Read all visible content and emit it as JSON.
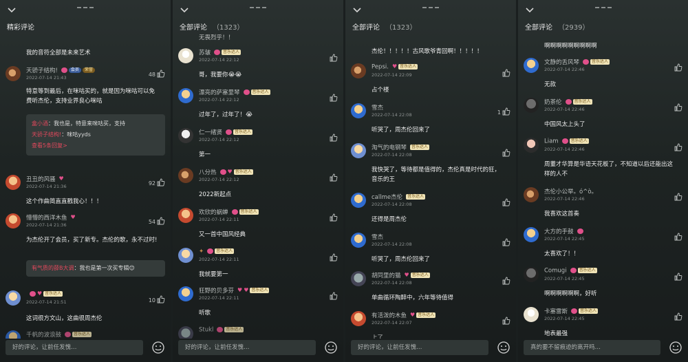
{
  "panels": [
    {
      "title": "精彩评论",
      "count": "",
      "input_placeholder": "好的评论，让前任发愧…",
      "lead_text": "我的音符全部是未来艺术",
      "comments": [
        {
          "name": "天骄子结构!",
          "date": "2022-07-14 21:43",
          "likes": "48",
          "content": "特意等到最后，在咪咕买的，就是因为咪咕可以免费听杰伦，支持业界良心咪咕",
          "badges": [
            "pink",
            "blue",
            "gold"
          ],
          "badge_text": {
            "blue": "会员",
            "gold": "荣誉"
          }
        },
        {
          "name": "丑丑的风骚",
          "date": "2022-07-14 21:36",
          "likes": "92",
          "content": "这个作曲简直直戳我心！！！",
          "badges": [
            "heart"
          ]
        },
        {
          "name": "懵懵的西洋木鱼",
          "date": "2022-07-14 21:36",
          "likes": "54",
          "content": "为杰伦开了会员，买了新专。杰伦的歌，永不过时!",
          "badges": [
            "heart"
          ]
        },
        {
          "name": "",
          "date": "2022-07-14 21:51",
          "likes": "10",
          "content": "这词很方文山，这曲很周杰伦",
          "badges": [
            "pink",
            "heart",
            "lv"
          ]
        },
        {
          "name": "千帆的波浪鼓",
          "date": "",
          "likes": "",
          "content": "",
          "badges": [
            "pink",
            "lv"
          ]
        }
      ],
      "replies": [
        {
          "name": "盒小酒",
          "text": "我也是，特意来咪咕买，支持"
        },
        {
          "name": "天骄子结构!",
          "text": "咪咕yyds"
        }
      ],
      "reply_more": "查看5条回复>",
      "reply2": {
        "name": "有气质的薛B大调",
        "text": "我也是第一次买专辑😊"
      }
    },
    {
      "title": "全部评论",
      "count": "（1323）",
      "input_placeholder": "好的评论，让前任发愧…",
      "lead_text": "无畏烈乎！！",
      "comments": [
        {
          "name": "苏皱",
          "date": "2022-07-14 22:12",
          "content": "哥，我要你😭😭",
          "badges": [
            "pink",
            "lv"
          ]
        },
        {
          "name": "漂亮的萨塞里琴",
          "date": "2022-07-14 22:12",
          "content": "过年了，过年了！😭",
          "badges": [
            "pink",
            "lv"
          ]
        },
        {
          "name": "仁一绪贤",
          "date": "2022-07-14 22:12",
          "content": "第一",
          "badges": [
            "pink",
            "lv"
          ]
        },
        {
          "name": "八分热",
          "date": "2022-07-14 22:12",
          "content": "2022新起点",
          "badges": [
            "pink",
            "heart",
            "lv"
          ]
        },
        {
          "name": "欢欣的蜗蝉",
          "date": "2022-07-14 22:11",
          "content": "又一首中国风经典",
          "badges": [
            "pink",
            "lv"
          ]
        },
        {
          "name": "",
          "date": "2022-07-14 22:11",
          "content": "我就要第一",
          "badges": [
            "pink",
            "lv"
          ]
        },
        {
          "name": "狂野的贝多芬",
          "date": "2022-07-14 22:11",
          "content": "听歌",
          "badges": [
            "heart",
            "heart",
            "lv"
          ]
        },
        {
          "name": "Stukl",
          "date": "",
          "content": "",
          "badges": [
            "pink",
            "lv"
          ]
        }
      ]
    },
    {
      "title": "全部评论",
      "count": "（1323）",
      "input_placeholder": "好的评论，让前任发愧…",
      "lead_text": "杰伦！！！！！古风歌爷青回啊！！！！！",
      "comments": [
        {
          "name": "Pepsi.",
          "date": "2022-07-14 22:09",
          "likes": "",
          "content": "占个楼",
          "badges": [
            "heart",
            "lv"
          ]
        },
        {
          "name": "雪杰",
          "date": "2022-07-14 22:08",
          "likes": "1",
          "content": "听哭了，周杰伦回来了",
          "badges": []
        },
        {
          "name": "淘气的电钢琴",
          "date": "2022-07-14 22:08",
          "likes": "",
          "content": "我快哭了，等待都是值得的，杰伦真是时代的狂，音乐的王",
          "badges": [
            "lv"
          ]
        },
        {
          "name": "callme杰伦",
          "date": "2022-07-14 22:08",
          "likes": "",
          "content": "还得是周杰伦",
          "badges": [
            "lv"
          ]
        },
        {
          "name": "雪杰",
          "date": "2022-07-14 22:08",
          "likes": "",
          "content": "听哭了，周杰伦回来了",
          "badges": []
        },
        {
          "name": "胡同里的猫",
          "date": "2022-07-14 22:08",
          "likes": "",
          "content": "单曲循环陶醉中，六年等待值得",
          "badges": [
            "heart",
            "lv"
          ]
        },
        {
          "name": "有活泼的木鱼",
          "date": "2022-07-14 22:07",
          "likes": "",
          "content": "上了",
          "badges": [
            "heart",
            "lv"
          ]
        }
      ]
    },
    {
      "title": "全部评论",
      "count": "（2939）",
      "input_placeholder": "真的要不留痕迹的离开吗…",
      "lead_text": "啊啊啊啊啊啊啊啊啊",
      "comments": [
        {
          "name": "文静的舌风琴",
          "date": "2022-07-14 22:46",
          "content": "无款",
          "badges": [
            "pink",
            "lv"
          ]
        },
        {
          "name": "奶茶伦",
          "date": "2022-07-14 22:46",
          "content": "中国风太上头了",
          "badges": [
            "pink",
            "lv"
          ]
        },
        {
          "name": "Liam",
          "date": "2022-07-14 22:46",
          "content": "周董才华算是华语天花板了，不知道以后还能出这样的人不",
          "badges": [
            "pink",
            "lv"
          ]
        },
        {
          "name": "杰伦小公举。ó^ò。",
          "date": "2022-07-14 22:46",
          "content": "我喜欢这首奏",
          "badges": []
        },
        {
          "name": "大方的手鼓",
          "date": "2022-07-14 22:45",
          "content": "太喜欢了！！",
          "badges": [
            "pink"
          ]
        },
        {
          "name": "Comugi",
          "date": "2022-07-14 22:45",
          "content": "啊啊啊啊啊啊，好听",
          "badges": [
            "pink",
            "lv"
          ]
        },
        {
          "name": "卡塞雷斯",
          "date": "2022-07-14 22:45",
          "content": "地表最强",
          "badges": [
            "pink",
            "lv"
          ]
        }
      ]
    }
  ],
  "lv_label": "音乐达人",
  "colors": {
    "bg": "#1e2423",
    "accent": "#e1485c",
    "badge_pink": "#e0508a"
  }
}
